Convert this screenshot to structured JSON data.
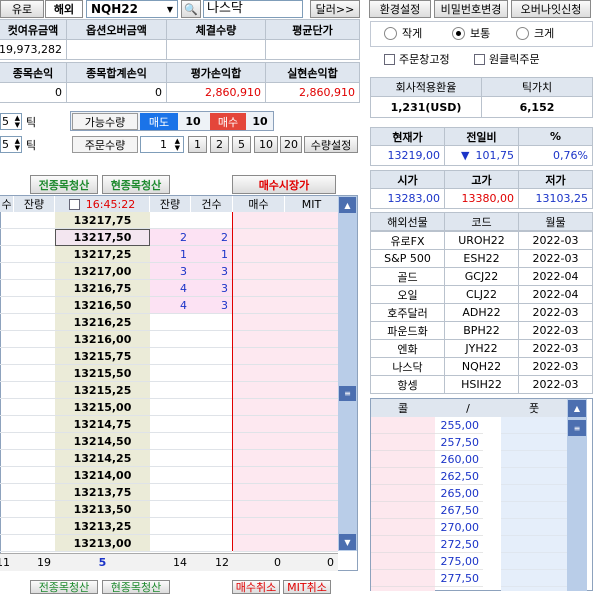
{
  "top": {
    "tab_yuro": "유로",
    "tab_haeoe": "해외",
    "symbol_code": "NQH22",
    "symbol_name": "나스닥",
    "dalle_btn": "달러>>",
    "btn_env": "환경설정",
    "btn_pw": "비밀번호변경",
    "btn_overnight": "오버나잇신청"
  },
  "account": {
    "h1": "컷여유금액",
    "h2": "옵션오버금액",
    "h3": "체결수량",
    "h4": "평균단가",
    "v1": "19,973,282",
    "v2": "",
    "v3": "",
    "v4": "",
    "h5": "종목손익",
    "h6": "종목합계손익",
    "h7": "평가손익합",
    "h8": "실현손익합",
    "v5": "0",
    "v6": "0",
    "v7": "2,860,910",
    "v8": "2,860,910"
  },
  "controls": {
    "tick1_val": "5",
    "tick_label": "틱",
    "tick2_val": "5",
    "tick2_label": "틱",
    "avail_label": "가능수량",
    "sell_label": "매도",
    "sell_qty": "10",
    "buy_label": "매수",
    "buy_qty": "10",
    "order_label": "주문수량",
    "order_qty": "1",
    "q1": "1",
    "q2": "2",
    "q3": "5",
    "q4": "10",
    "q5": "20",
    "qty_setting": "수량설정"
  },
  "grid_top_buttons": {
    "all_close": "전종목청산",
    "cur_close": "현종목청산",
    "market_buy": "매수시장가"
  },
  "grid_header": {
    "c1": "수",
    "c2": "잔량",
    "time": "16:45:22",
    "c4": "잔량",
    "c5": "건수",
    "c6": "매수",
    "c7": "MIT"
  },
  "prices": [
    "13217,75",
    "13217,50",
    "13217,25",
    "13217,00",
    "13216,75",
    "13216,50",
    "13216,25",
    "13216,00",
    "13215,75",
    "13215,50",
    "13215,25",
    "13215,00",
    "13214,75",
    "13214,50",
    "13214,25",
    "13214,00",
    "13213,75",
    "13213,50",
    "13213,25",
    "13213,00"
  ],
  "bid_qty": [
    "",
    "2",
    "1",
    "3",
    "4",
    "4",
    "",
    "",
    "",
    "",
    "",
    "",
    "",
    "",
    "",
    "",
    "",
    "",
    "",
    ""
  ],
  "bid_cnt": [
    "",
    "2",
    "1",
    "3",
    "3",
    "3",
    "",
    "",
    "",
    "",
    "",
    "",
    "",
    "",
    "",
    "",
    "",
    "",
    "",
    ""
  ],
  "grid_footer": {
    "f1": "11",
    "f2": "19",
    "f3": "5",
    "f4": "14",
    "f5": "12",
    "f6": "0",
    "f7": "0"
  },
  "grid_bottom_buttons": {
    "all_close": "전종목청산",
    "cur_close": "현종목청산",
    "buy_cancel": "매수취소",
    "mit_cancel": "MIT취소"
  },
  "right": {
    "size_small": "작게",
    "size_normal": "보통",
    "size_large": "크게",
    "order_fix": "주문창고정",
    "one_click": "원클릭주문",
    "fx_label": "회사적용환율",
    "tick_value_label": "틱가치",
    "fx_value": "1,231(USD)",
    "tick_value": "6,152",
    "cur_label": "현재가",
    "diff_label": "전일비",
    "pct_label": "%",
    "cur_value": "13219,00",
    "diff_value": "101,75",
    "pct_value": "0,76%",
    "open_label": "시가",
    "high_label": "고가",
    "low_label": "저가",
    "open_value": "13283,00",
    "high_value": "13380,00",
    "low_value": "13103,25",
    "list_h1": "해외선물",
    "list_h2": "코드",
    "list_h3": "월물",
    "list": [
      {
        "name": "유로FX",
        "code": "UROH22",
        "month": "2022-03"
      },
      {
        "name": "S&P 500",
        "code": "ESH22",
        "month": "2022-03"
      },
      {
        "name": "골드",
        "code": "GCJ22",
        "month": "2022-04"
      },
      {
        "name": "오일",
        "code": "CLJ22",
        "month": "2022-04"
      },
      {
        "name": "호주달러",
        "code": "ADH22",
        "month": "2022-03"
      },
      {
        "name": "파운드화",
        "code": "BPH22",
        "month": "2022-03"
      },
      {
        "name": "엔화",
        "code": "JYH22",
        "month": "2022-03"
      },
      {
        "name": "나스닥",
        "code": "NQH22",
        "month": "2022-03"
      },
      {
        "name": "항셍",
        "code": "HSIH22",
        "month": "2022-03"
      }
    ],
    "opt_h1": "콜",
    "opt_h2": "/",
    "opt_h3": "풋",
    "strikes": [
      "255,00",
      "257,50",
      "260,00",
      "262,50",
      "265,00",
      "267,50",
      "270,00",
      "272,50",
      "275,00",
      "277,50"
    ]
  }
}
